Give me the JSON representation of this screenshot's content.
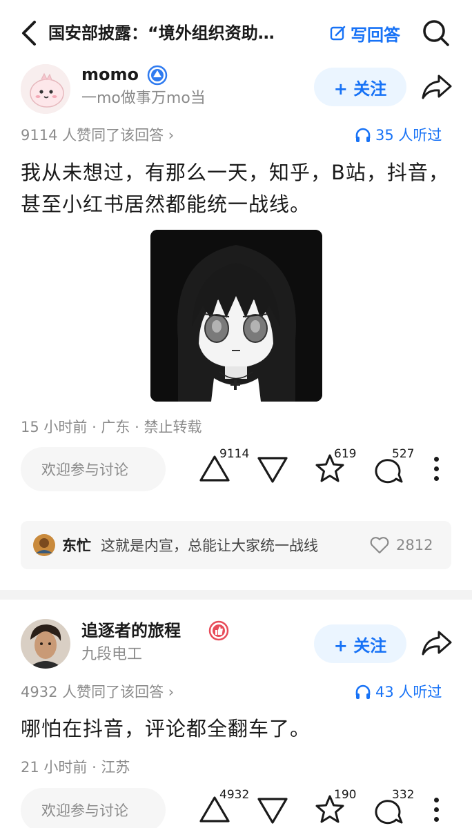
{
  "header": {
    "title": "国安部披露：“境外组织资助…",
    "write_answer": "写回答"
  },
  "answers": [
    {
      "author": "momo",
      "bio": "一mo做事万mo当",
      "follow": "+ 关注",
      "likes_text": "9114 人赞同了该回答 ›",
      "listen_text": "35 人听过",
      "content": "我从未想过，有那么一天，知乎，B站，抖音，甚至小红书居然都能统一战线。",
      "meta": "15 小时前 · 广东 · 禁止转载",
      "comment_placeholder": "欢迎参与讨论",
      "upvotes": "9114",
      "favorites": "619",
      "comments": "527"
    },
    {
      "author": "追逐者的旅程",
      "bio": "九段电工",
      "follow": "+ 关注",
      "likes_text": "4932 人赞同了该回答 ›",
      "listen_text": "43 人听过",
      "content": "哪怕在抖音，评论都全翻车了。",
      "meta": "21 小时前 · 江苏",
      "comment_placeholder": "欢迎参与讨论",
      "upvotes": "4932",
      "favorites": "190",
      "comments": "332"
    }
  ],
  "hot_comment": {
    "name": "东忙",
    "text": "这就是内宣，总能让大家统一战线",
    "likes": "2812"
  },
  "colors": {
    "accent": "#1772f6",
    "muted": "#8a8a8a",
    "badge_blue": "#2f7bf0",
    "badge_red": "#e84c5a"
  }
}
